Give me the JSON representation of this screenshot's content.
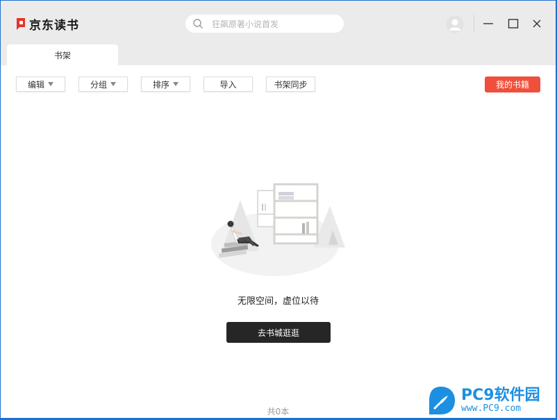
{
  "app": {
    "title": "京东读书"
  },
  "search": {
    "placeholder": "狂飙原著小说首发"
  },
  "tabs": [
    {
      "label": "书架"
    }
  ],
  "toolbar": {
    "edit_label": "编辑",
    "group_label": "分组",
    "sort_label": "排序",
    "import_label": "导入",
    "sync_label": "书架同步",
    "my_books_label": "我的书籍"
  },
  "empty_state": {
    "message": "无限空间，虚位以待",
    "cta_label": "去书城逛逛"
  },
  "footer": {
    "total": "共0本"
  },
  "watermark": {
    "title": "PC9软件园",
    "url": "www.PC9.com"
  },
  "colors": {
    "accent": "#ef4f3b",
    "brand": "#e5322d",
    "cta_bg": "#262626",
    "titlebar": "#ebebeb"
  },
  "icons": [
    "jd-read-logo-icon",
    "search-icon",
    "avatar-icon",
    "minimize-icon",
    "maximize-icon",
    "close-icon",
    "empty-bookshelf-illustration"
  ]
}
